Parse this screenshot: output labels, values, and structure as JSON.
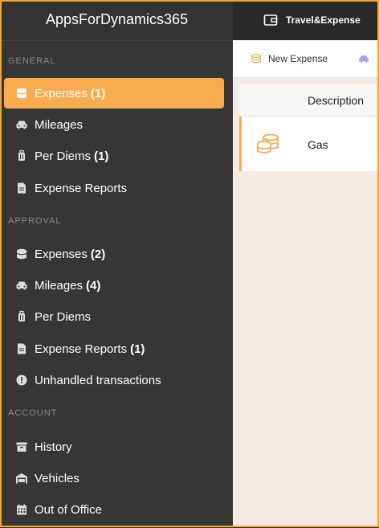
{
  "brand": "AppsForDynamics365",
  "module": {
    "label": "Travel&Expense",
    "icon": "wallet-icon"
  },
  "colors": {
    "accent": "#f9ab50",
    "sidebar_bg": "#363636",
    "topbar_bg": "#333333",
    "frame": "#f5a623"
  },
  "sidebar": {
    "sections": [
      {
        "label": "GENERAL"
      },
      {
        "label": "APPROVAL"
      },
      {
        "label": "ACCOUNT"
      }
    ],
    "general": [
      {
        "label": "Expenses",
        "count": "(1)",
        "icon": "coins-icon",
        "active": true
      },
      {
        "label": "Mileages",
        "count": "",
        "icon": "car-icon"
      },
      {
        "label": "Per Diems",
        "count": "(1)",
        "icon": "suitcase-icon"
      },
      {
        "label": "Expense Reports",
        "count": "",
        "icon": "document-icon"
      }
    ],
    "approval": [
      {
        "label": "Expenses",
        "count": "(2)",
        "icon": "coins-icon"
      },
      {
        "label": "Mileages",
        "count": "(4)",
        "icon": "car-icon"
      },
      {
        "label": "Per Diems",
        "count": "",
        "icon": "suitcase-icon"
      },
      {
        "label": "Expense Reports",
        "count": "(1)",
        "icon": "document-icon"
      },
      {
        "label": "Unhandled transactions",
        "count": "",
        "icon": "exclamation-circle-icon"
      }
    ],
    "account": [
      {
        "label": "History",
        "count": "",
        "icon": "archive-icon"
      },
      {
        "label": "Vehicles",
        "count": "",
        "icon": "garage-icon"
      },
      {
        "label": "Out of Office",
        "count": "",
        "icon": "calendar-icon"
      }
    ]
  },
  "toolbar": {
    "new_expense": "New Expense"
  },
  "table": {
    "columns": [
      "Description"
    ],
    "rows": [
      {
        "description": "Gas",
        "icon": "coins-icon"
      }
    ]
  }
}
